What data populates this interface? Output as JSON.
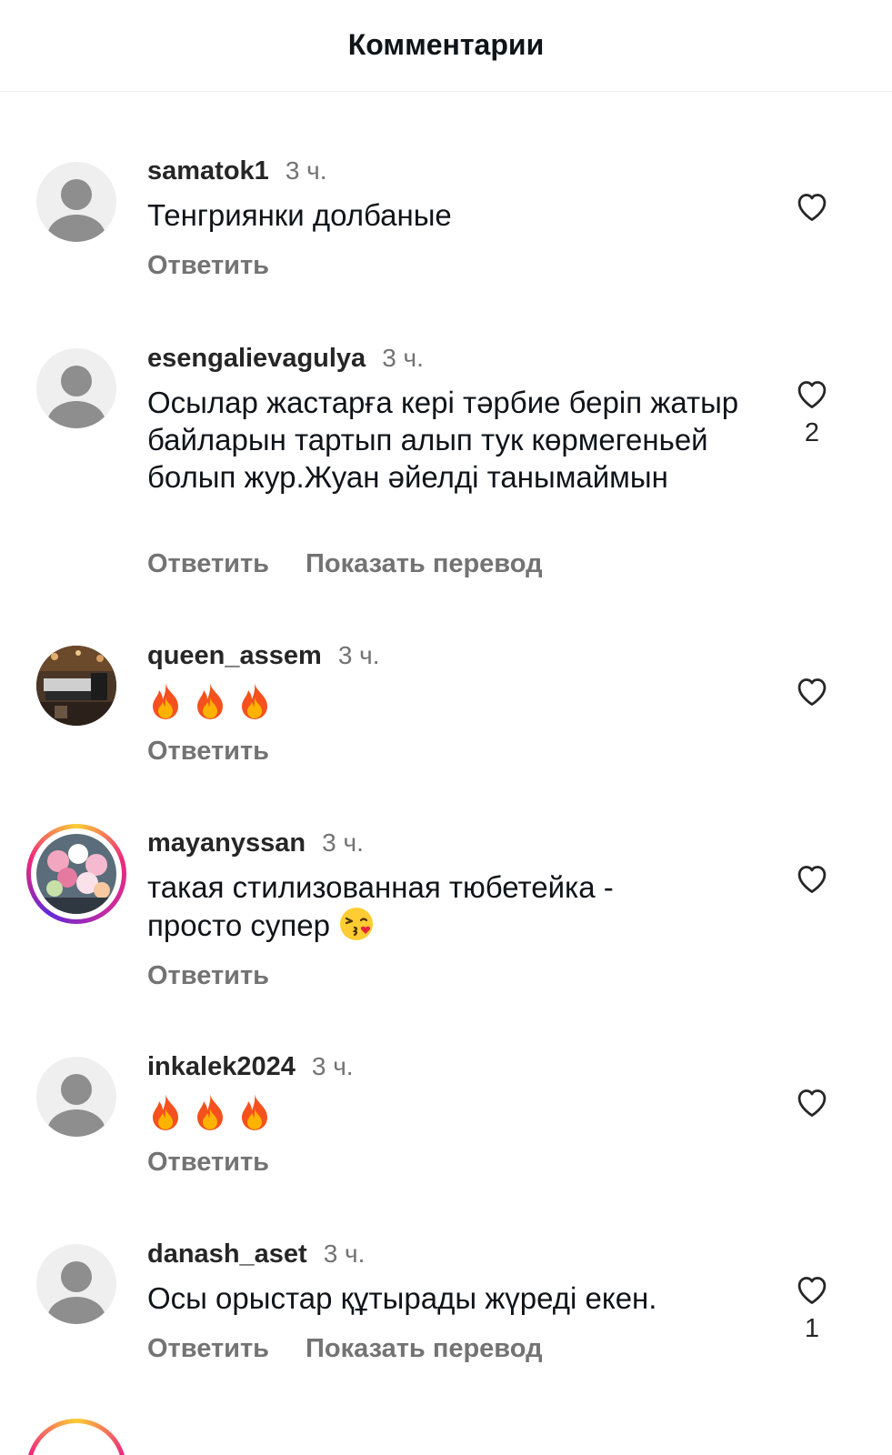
{
  "header": {
    "title": "Комментарии"
  },
  "reply_label": "Ответить",
  "translate_label": "Показать перевод",
  "comments": [
    {
      "username": "samatok1",
      "time": "3 ч.",
      "text": "Тенгриянки долбаные",
      "likes": "",
      "avatar": "default-avatar-icon",
      "show_translate": false
    },
    {
      "username": "esengalievagulya",
      "time": "3 ч.",
      "text": "Осылар жастарға кері тәрбие беріп жатыр байларын тартып алып тук көрмегеньей болып жур.Жуан әйелді танымаймын",
      "likes": "2",
      "avatar": "default-avatar-icon",
      "show_translate": true
    },
    {
      "username": "queen_assem",
      "time": "3 ч.",
      "text": "",
      "emoji": [
        "fire",
        "fire",
        "fire"
      ],
      "likes": "",
      "avatar": "photo-avatar",
      "show_translate": false
    },
    {
      "username": "mayanyssan",
      "time": "3 ч.",
      "text": "такая стилизованная тюбетейка - просто супер",
      "emoji": [
        "kissing-face"
      ],
      "likes": "",
      "avatar": "story-ring-photo-avatar",
      "show_translate": false
    },
    {
      "username": "inkalek2024",
      "time": "3 ч.",
      "text": "",
      "emoji": [
        "fire",
        "fire",
        "fire"
      ],
      "likes": "",
      "avatar": "default-avatar-icon",
      "show_translate": false
    },
    {
      "username": "danash_aset",
      "time": "3 ч.",
      "text": "Осы орыстар құтырады жүреді екен.",
      "likes": "1",
      "avatar": "default-avatar-icon",
      "show_translate": true
    }
  ],
  "colors": {
    "username": "#262626",
    "secondary": "#737373",
    "story_ring": "#ee2a7b",
    "avatar_bg": "#efefef",
    "avatar_icon": "#8e8e8e"
  }
}
